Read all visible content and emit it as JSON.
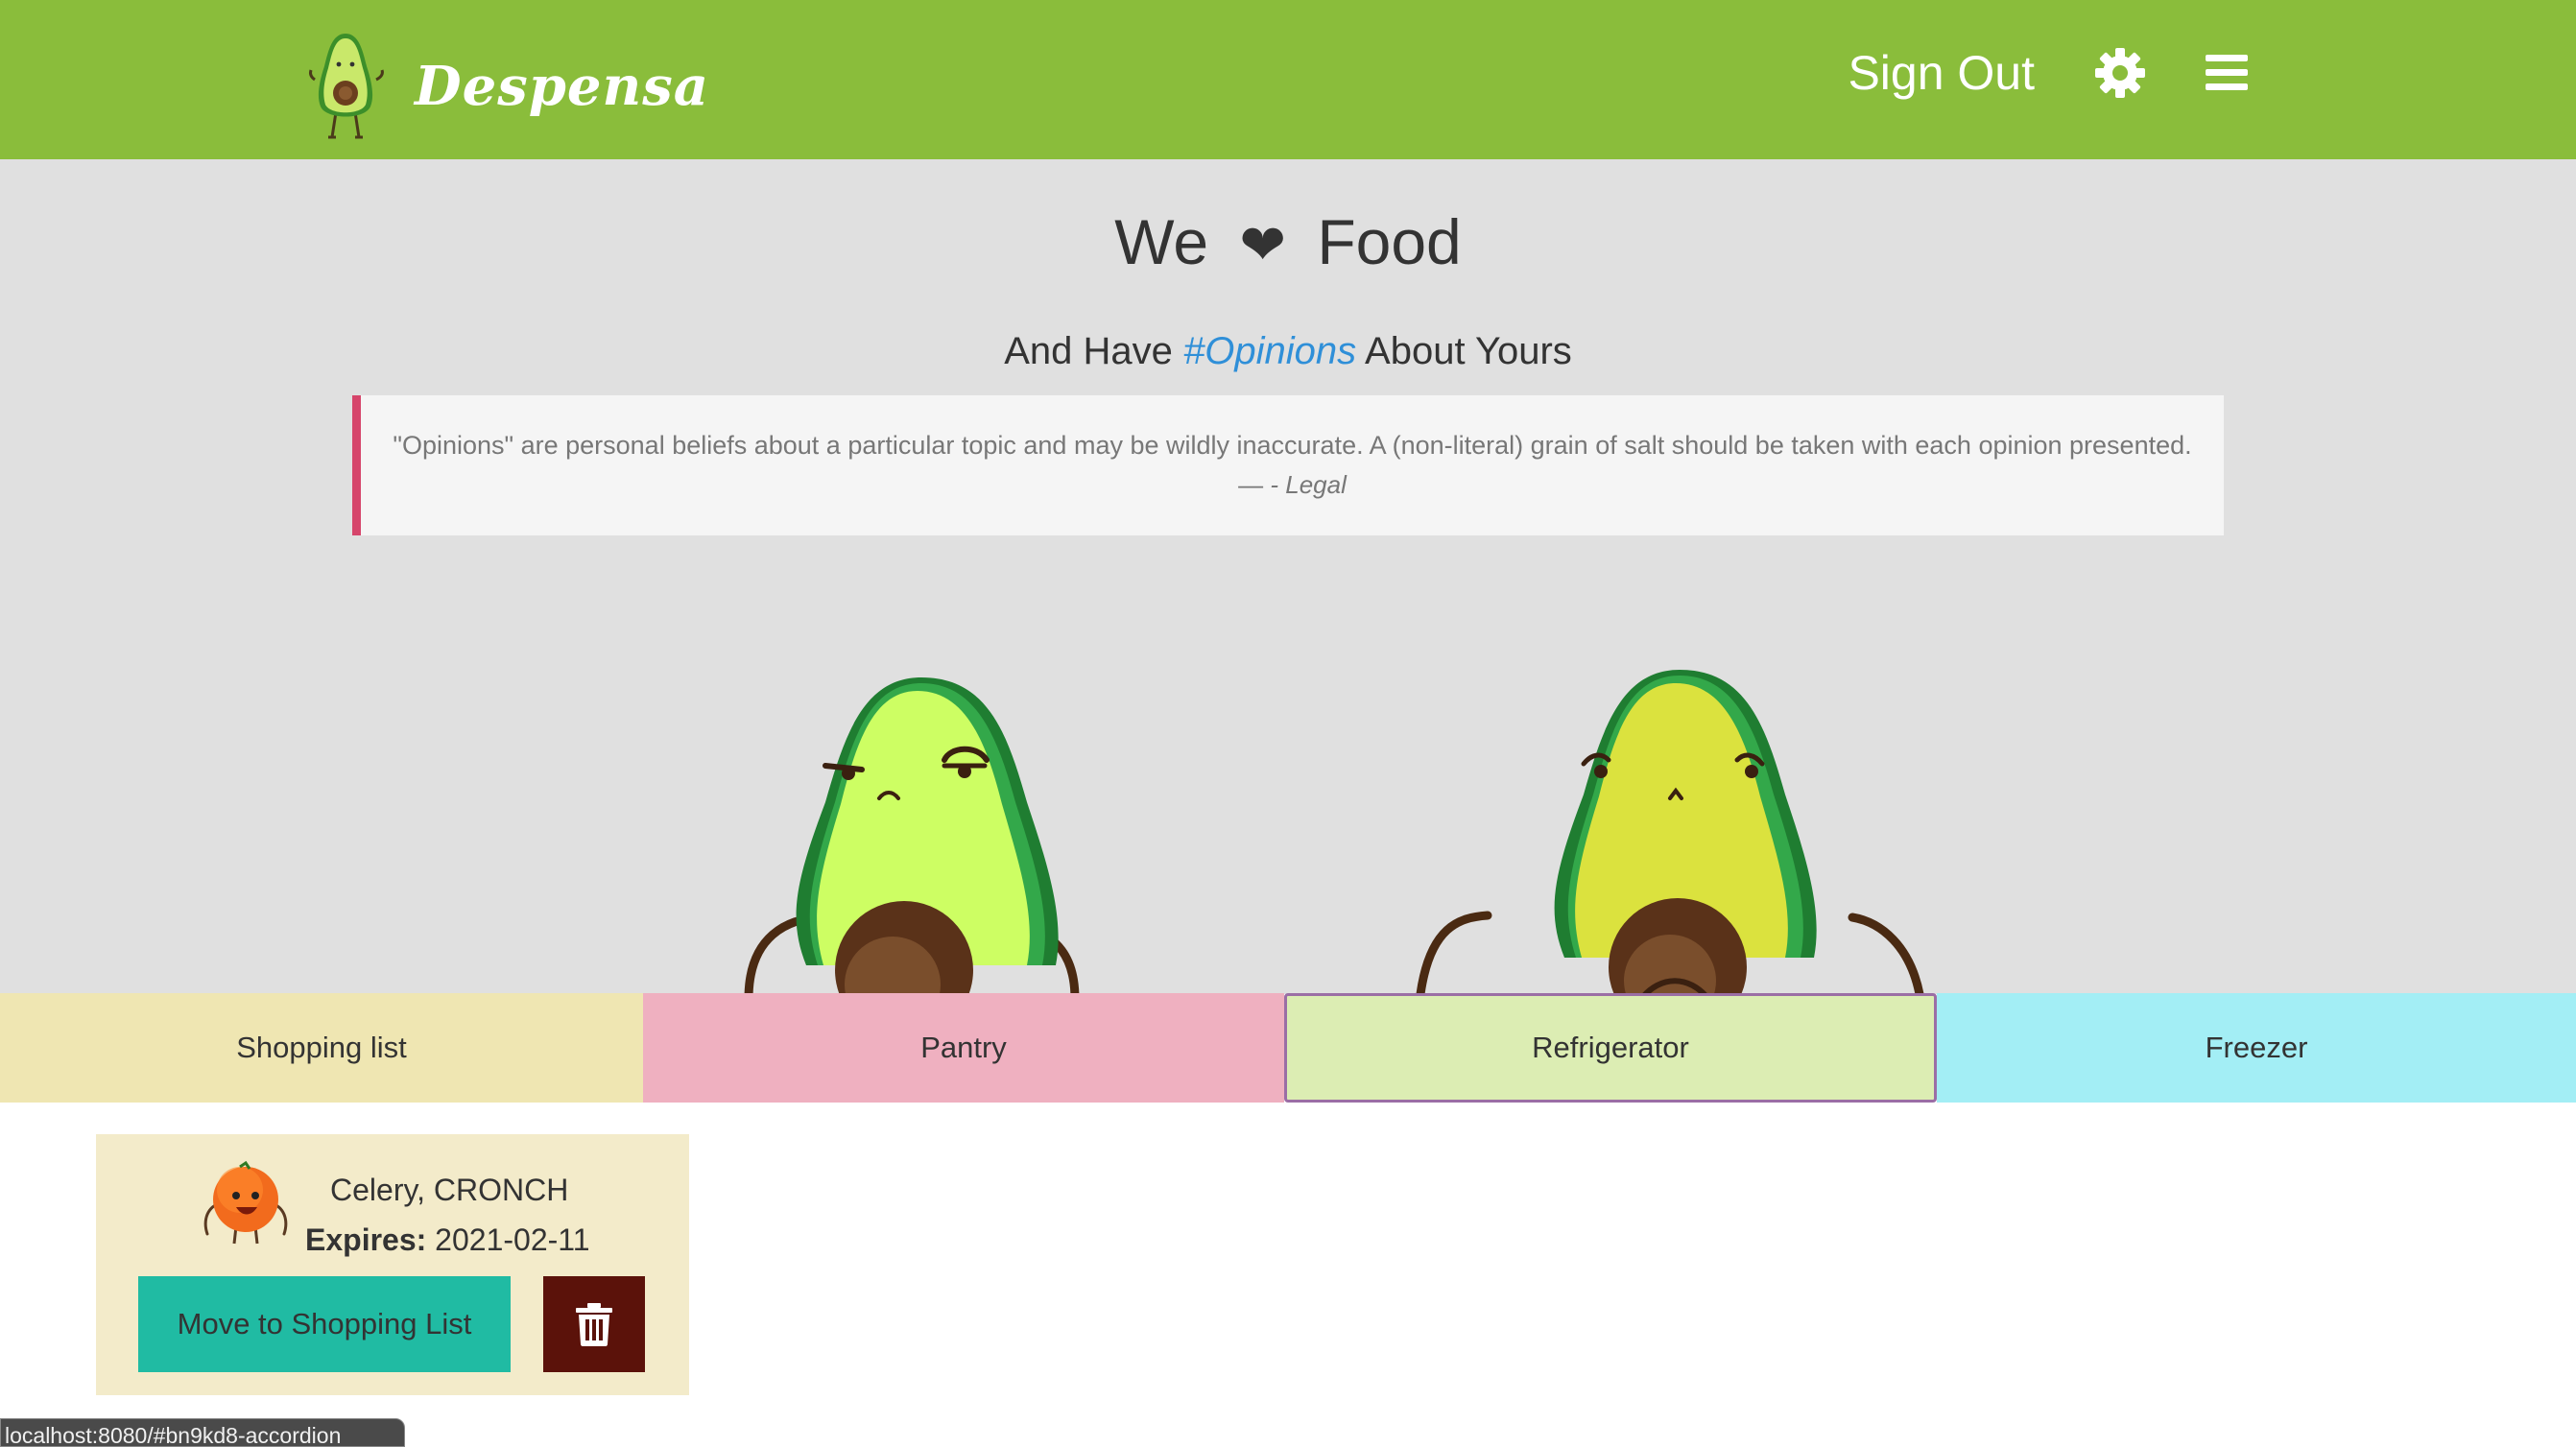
{
  "navbar": {
    "brand": "Despensa",
    "sign_out": "Sign Out",
    "icons": [
      "avocado-logo-icon",
      "gear-icon",
      "hamburger-menu-icon"
    ]
  },
  "hero": {
    "title_left": "We",
    "title_heart": "❤",
    "title_right": "Food",
    "subtitle_pre": "And Have",
    "subtitle_tag": "#Opinions",
    "subtitle_post": "About Yours",
    "quote": "\"Opinions\" are personal beliefs about a particular topic and may be wildly inaccurate. A (non-literal) grain of salt should be taken with each opinion presented.",
    "quote_dash": "— ",
    "quote_source": "- Legal"
  },
  "tabs": {
    "shopping": "Shopping list",
    "pantry": "Pantry",
    "refrigerator": "Refrigerator",
    "freezer": "Freezer",
    "active": "Refrigerator"
  },
  "card": {
    "name": "Celery, CRONCH",
    "expires_label": "Expires:",
    "expires_value": "2021-02-11",
    "move_label": "Move to Shopping List",
    "icon": "orange-creature-icon"
  },
  "status_bar": {
    "url": "localhost:8080/#bn9kd8-accordion"
  },
  "colors": {
    "navbar": "#8abd3b",
    "hero_bg": "#e0e0e0",
    "accent_tag": "#2f8fd8",
    "quote_border": "#d6456b",
    "tab_shopping": "#efe6b2",
    "tab_pantry": "#efb0c0",
    "tab_refrigerator": "#dcedb3",
    "tab_freezer": "#a3eef5",
    "card_bg": "#f3ebca",
    "move_button": "#20bba3",
    "trash_button": "#5b120a"
  }
}
